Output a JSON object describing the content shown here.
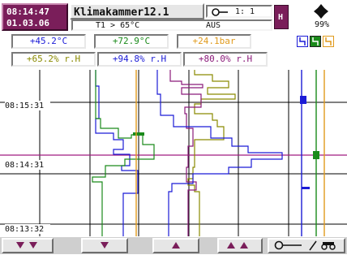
{
  "header": {
    "time": "08:14:47",
    "date": "01.03.06",
    "title": "Klimakammer12.1",
    "channel": "1: 1",
    "condition": "T1 > 65°C",
    "state": "AUS",
    "mode_badge": "H",
    "memory_percent": "99%",
    "memory_icon": "disk-nav-icon"
  },
  "values_row1": [
    {
      "text": "+45.2°C",
      "color": "#1b1bd6"
    },
    {
      "text": "+72.9°C",
      "color": "#1a8a1a"
    },
    {
      "text": "+24.1bar",
      "color": "#e09a1c"
    }
  ],
  "values_row2": [
    {
      "text": "+65.2% r.H",
      "color": "#8a8a00"
    },
    {
      "text": "+94.8% r.H",
      "color": "#1b1bd6"
    },
    {
      "text": "+80.0% r.H",
      "color": "#8b1a7a"
    }
  ],
  "legend_colors": [
    "#1b1bd6",
    "#1a8a1a",
    "#e09a1c"
  ],
  "chart": {
    "time_labels": [
      "08:15:31",
      "08:14:31",
      "08:13:32"
    ],
    "grid_color": "#000000",
    "marker_line_color": "#a01a80"
  },
  "toolbar": {
    "buttons": [
      "scroll-down-fast-icon",
      "scroll-down-icon",
      "scroll-up-icon",
      "scroll-up-fast-icon",
      "key-search-icon"
    ]
  }
}
